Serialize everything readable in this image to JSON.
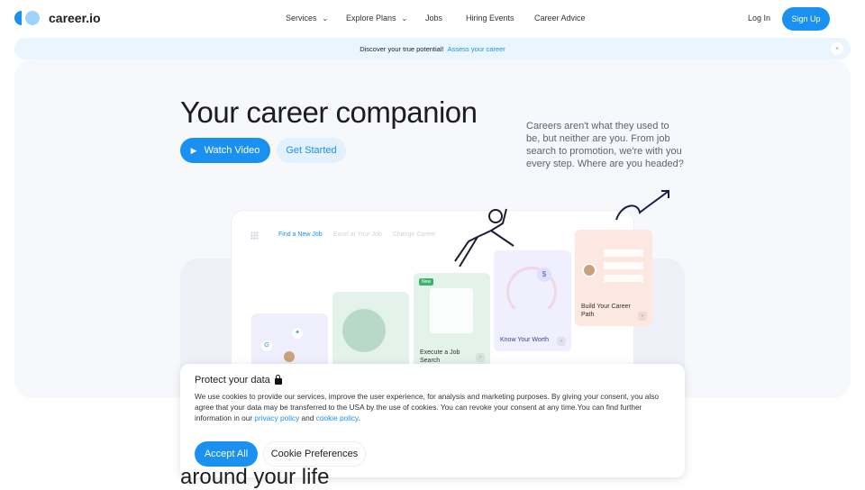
{
  "header": {
    "logo": "career.io",
    "nav": [
      {
        "label": "Services",
        "dropdown": true
      },
      {
        "label": "Explore Plans",
        "dropdown": true
      },
      {
        "label": "Jobs"
      },
      {
        "label": "Hiring Events"
      },
      {
        "label": "Career Advice"
      }
    ],
    "login": "Log In",
    "signup": "Sign Up"
  },
  "banner": {
    "text": "Discover your true potential!",
    "link": "Assess your career",
    "close": "×"
  },
  "hero": {
    "title": "Your career companion",
    "watch": "Watch Video",
    "start": "Get Started",
    "description": "Careers aren't what they used to be, but neither are you. From job search to promotion, we're with you every step. Where are you headed?"
  },
  "showcase": {
    "tabs": [
      "Find a New Job",
      "Excel at Your Job",
      "Change Career"
    ],
    "cards": {
      "execute": "Execute a Job Search",
      "new_badge": "New",
      "worth": "Know Your Worth",
      "path": "Build Your Career Path",
      "dollar": "$"
    }
  },
  "cookie": {
    "title": "Protect your data",
    "body": "We use cookies to provide our services, improve the user experience, for analysis and marketing purposes. By giving your consent, you also agree that your data may be transferred to the USA by the use of cookies. You can revoke your consent at any time.You can find further information in our ",
    "privacy": "privacy policy",
    "and": " and ",
    "cookie_link": "cookie policy",
    "end": ".",
    "accept": "Accept All",
    "prefs": "Cookie Preferences"
  },
  "below": {
    "text": "around your life"
  },
  "colors": {
    "accent": "#1a91f0",
    "banner": "#eaf6ff"
  }
}
